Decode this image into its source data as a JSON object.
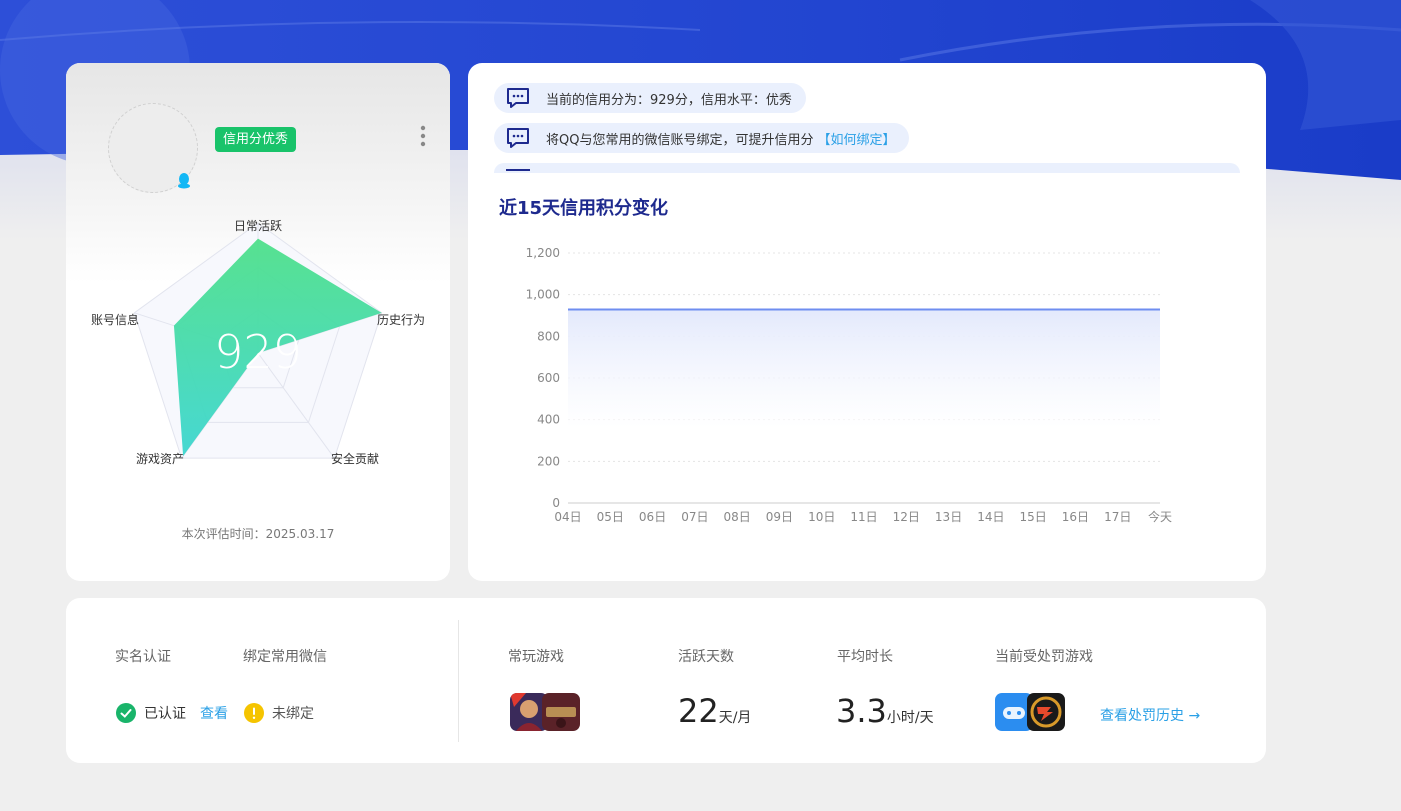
{
  "profile": {
    "badge": "信用分优秀",
    "score": "929",
    "radar_labels": {
      "daily": "日常活跃",
      "history": "历史行为",
      "security": "安全贡献",
      "assets": "游戏资产",
      "account": "账号信息"
    },
    "eval_time": "本次评估时间：2025.03.17"
  },
  "messages": [
    {
      "text": "当前的信用分为：929分，信用水平：优秀",
      "link": ""
    },
    {
      "text": "将QQ与您常用的微信账号绑定，可提升信用分",
      "link": "【如何绑定】"
    }
  ],
  "chart_title": "近15天信用积分变化",
  "chart_data": {
    "type": "area",
    "title": "近15天信用积分变化",
    "categories": [
      "04日",
      "05日",
      "06日",
      "07日",
      "08日",
      "09日",
      "10日",
      "11日",
      "12日",
      "13日",
      "14日",
      "15日",
      "16日",
      "17日",
      "今天"
    ],
    "series": [
      {
        "values": [
          929,
          929,
          929,
          929,
          929,
          929,
          929,
          929,
          929,
          929,
          929,
          929,
          929,
          929,
          929
        ]
      }
    ],
    "y_ticks": [
      "0",
      "200",
      "400",
      "600",
      "800",
      "1,000",
      "1,200"
    ],
    "ylim": [
      0,
      1200
    ],
    "grid": true,
    "line_color": "#6f8ef0",
    "fill_color": "#e3e9fc"
  },
  "stats": {
    "real_name_label": "实名认证",
    "wechat_label": "绑定常用微信",
    "real_name_status": "已认证",
    "real_name_view": "查看",
    "wechat_status": "未绑定",
    "games_label": "常玩游戏",
    "active_days_label": "活跃天数",
    "active_days_value": "22",
    "active_days_unit": "天/月",
    "avg_time_label": "平均时长",
    "avg_time_value": "3.3",
    "avg_time_unit": "小时/天",
    "punished_label": "当前受处罚游戏",
    "punish_history_link": "查看处罚历史 →"
  },
  "colors": {
    "accent_blue": "#2aa0e6",
    "title_navy": "#1e2a8e",
    "badge_green": "#19c36a",
    "success_green": "#19b46a",
    "warning_yellow": "#f5c400"
  }
}
